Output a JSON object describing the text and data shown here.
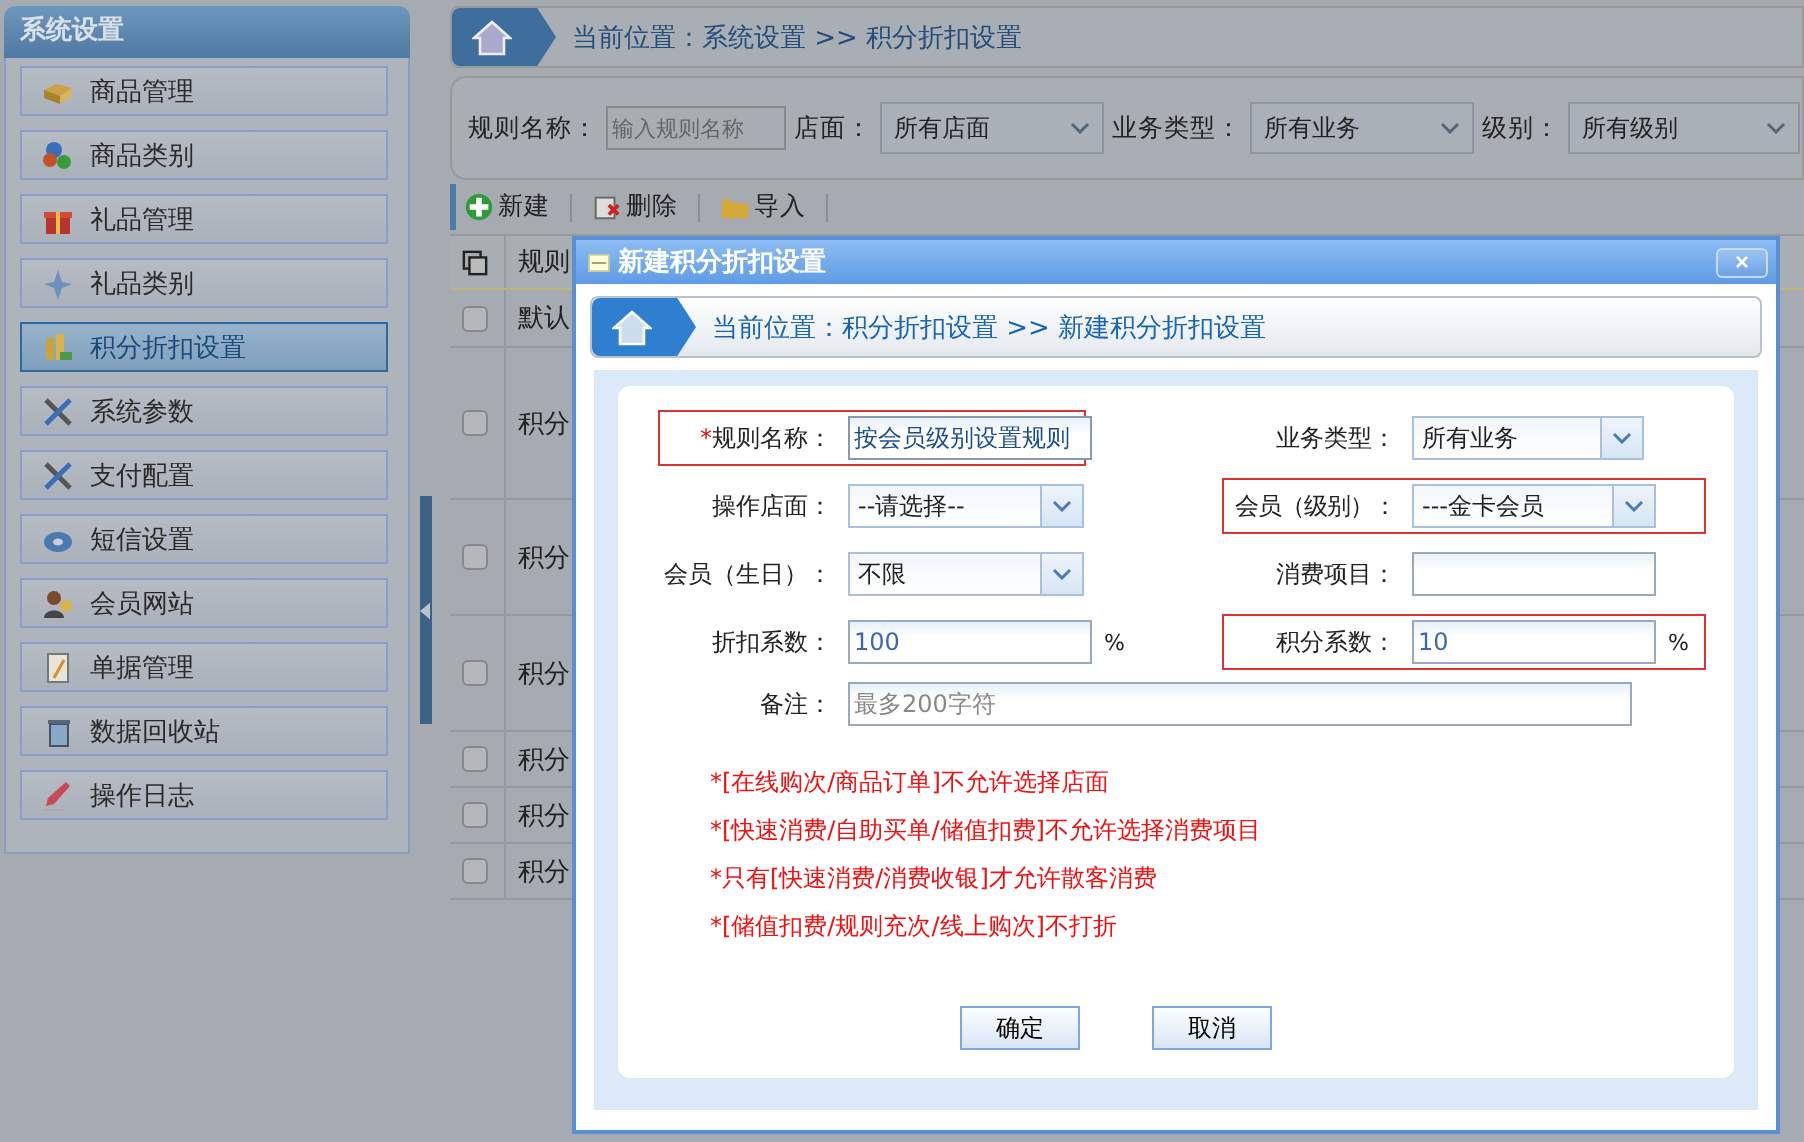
{
  "sidebar": {
    "title": "系统设置",
    "items": [
      {
        "label": "商品管理",
        "selected": false
      },
      {
        "label": "商品类别",
        "selected": false
      },
      {
        "label": "礼品管理",
        "selected": false
      },
      {
        "label": "礼品类别",
        "selected": false
      },
      {
        "label": "积分折扣设置",
        "selected": true
      },
      {
        "label": "系统参数",
        "selected": false
      },
      {
        "label": "支付配置",
        "selected": false
      },
      {
        "label": "短信设置",
        "selected": false
      },
      {
        "label": "会员网站",
        "selected": false
      },
      {
        "label": "单据管理",
        "selected": false
      },
      {
        "label": "数据回收站",
        "selected": false
      },
      {
        "label": "操作日志",
        "selected": false
      }
    ]
  },
  "breadcrumb": {
    "prefix": "当前位置：",
    "path": [
      "系统设置",
      "积分折扣设置"
    ],
    "separator": ">>"
  },
  "filters": [
    {
      "label": "规则名称：",
      "kind": "text",
      "placeholder": "输入规则名称"
    },
    {
      "label": "店面：",
      "kind": "select",
      "value": "所有店面"
    },
    {
      "label": "业务类型：",
      "kind": "select",
      "value": "所有业务"
    },
    {
      "label": "级别：",
      "kind": "select",
      "value": "所有级别"
    }
  ],
  "toolbar": [
    "新建",
    "删除",
    "导入"
  ],
  "table": {
    "columns": [
      "规则"
    ],
    "rows": [
      {
        "cell": "默认",
        "checked": false
      },
      {
        "cell": "积分",
        "checked": false
      },
      {
        "cell": "积分",
        "checked": false
      },
      {
        "cell": "积分",
        "checked": false
      },
      {
        "cell": "积分",
        "checked": false
      },
      {
        "cell": "积分",
        "checked": false
      },
      {
        "cell": "积分",
        "checked": false
      }
    ]
  },
  "dialog": {
    "title": "新建积分折扣设置",
    "close": "×",
    "breadcrumb": {
      "prefix": "当前位置：",
      "path": [
        "积分折扣设置",
        "新建积分折扣设置"
      ],
      "separator": ">>"
    },
    "fields": [
      {
        "label": "规则名称：",
        "required_mark": "*",
        "kind": "text",
        "value": "按会员级别设置规则",
        "highlighted": true
      },
      {
        "label": "业务类型：",
        "kind": "select",
        "value": "所有业务",
        "highlighted": false
      },
      {
        "label": "操作店面：",
        "kind": "select",
        "value": "--请选择--",
        "highlighted": false
      },
      {
        "label": "会员（级别）：",
        "kind": "select",
        "value": "---金卡会员",
        "highlighted": true
      },
      {
        "label": "会员（生日）：",
        "kind": "select",
        "value": "不限",
        "highlighted": false
      },
      {
        "label": "消费项目：",
        "kind": "text",
        "highlighted": false
      },
      {
        "label": "折扣系数：",
        "kind": "text",
        "value": "100",
        "unit": "%",
        "highlighted": false
      },
      {
        "label": "积分系数：",
        "kind": "text",
        "value": "10",
        "unit": "%",
        "highlighted": true
      },
      {
        "label": "备注：",
        "kind": "wide",
        "placeholder": "最多200字符",
        "highlighted": false
      }
    ],
    "notes": [
      "*[在线购次/商品订单]不允许选择店面",
      "*[快速消费/自助买单/储值扣费]不允许选择消费项目",
      "*只有[快速消费/消费收银]才允许散客消费",
      "*[储值扣费/规则充次/线上购次]不打折"
    ],
    "buttons": [
      "确定",
      "取消"
    ]
  }
}
